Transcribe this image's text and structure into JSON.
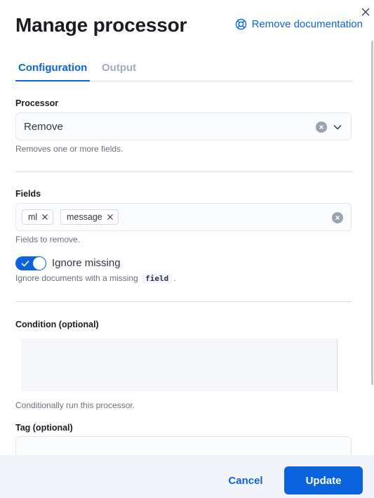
{
  "flyout": {
    "title": "Manage processor",
    "doc_link": "Remove documentation"
  },
  "tabs": [
    {
      "label": "Configuration",
      "active": true
    },
    {
      "label": "Output",
      "active": false
    }
  ],
  "form": {
    "processor": {
      "label": "Processor",
      "value": "Remove",
      "help": "Removes one or more fields."
    },
    "fields": {
      "label": "Fields",
      "values": [
        "ml",
        "message"
      ],
      "help": "Fields to remove."
    },
    "ignore_missing": {
      "label": "Ignore missing",
      "checked": true,
      "help_prefix": "Ignore documents with a missing",
      "help_code": "field",
      "help_suffix": "."
    },
    "condition": {
      "label": "Condition (optional)",
      "value": "",
      "help": "Conditionally run this processor."
    },
    "tag": {
      "label": "Tag (optional)",
      "value": ""
    }
  },
  "footer": {
    "cancel_label": "Cancel",
    "update_label": "Update"
  },
  "colors": {
    "primary": "#0b64dd",
    "footer_bg": "#f1f4fa",
    "inactive_tab": "#a2abba"
  },
  "icons": {
    "close": "close-icon",
    "doc": "lifebuoy-icon",
    "clear": "clear-circle-icon",
    "dropdown": "chevron-down-icon",
    "pill_remove": "cross-icon",
    "switch_check": "check-icon"
  }
}
